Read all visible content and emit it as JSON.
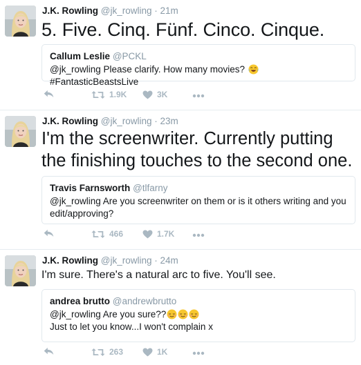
{
  "tweets": [
    {
      "author": "J.K. Rowling",
      "handle": "@jk_rowling",
      "time": "21m",
      "text": "5. Five. Cinq. Fünf. Cinco. Cinque.",
      "quote": {
        "author": "Callum Leslie",
        "handle": "@PCKL",
        "line1": "@jk_rowling Please clarify. How many movies?",
        "line1_tail": "#FantasticBeastsLive",
        "emojis": [
          "laughing-tears-emoji"
        ]
      },
      "retweets": "1.9K",
      "likes": "3K"
    },
    {
      "author": "J.K. Rowling",
      "handle": "@jk_rowling",
      "time": "23m",
      "text": "I'm the screenwriter. Currently putting the finishing touches to the second one.",
      "quote": {
        "author": "Travis Farnsworth",
        "handle": "@tlfarny",
        "line1": "@jk_rowling Are you screenwriter on them or is it others writing and you edit/approving?"
      },
      "retweets": "466",
      "likes": "1.7K"
    },
    {
      "author": "J.K. Rowling",
      "handle": "@jk_rowling",
      "time": "24m",
      "text": "I'm sure. There's a natural arc to five. You'll see.",
      "quote": {
        "author": "andrea brutto",
        "handle": "@andrewbrutto",
        "line1": "@jk_rowling Are you sure??",
        "line2": "Just to let you know...I won't complain x",
        "emojis": [
          "relieved-emoji",
          "relieved-emoji",
          "relieved-emoji"
        ]
      },
      "retweets": "263",
      "likes": "1K"
    }
  ],
  "separator": "·",
  "icons": [
    "avatar",
    "reply-icon",
    "retweet-icon",
    "like-icon",
    "more-icon"
  ],
  "colors": {
    "muted": "#8899a6",
    "icon": "#aab8c2",
    "border": "#e1e8ed"
  }
}
